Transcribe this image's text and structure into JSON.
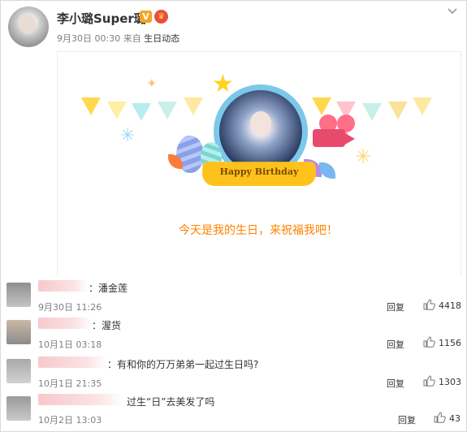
{
  "post": {
    "author": "李小璐Super璐",
    "verified_badge": "V",
    "crown_badge": "♛",
    "date": "9月30日 00:30",
    "from_label": "来自",
    "source": "生日动态",
    "card": {
      "ribbon_text": "Happy Birthday",
      "headline": "今天是我的生日，来祝福我吧！"
    }
  },
  "comments": [
    {
      "text": "：潘金莲",
      "time": "9月30日 11:26",
      "reply": "回复",
      "likes": "4418"
    },
    {
      "text": "：渥货",
      "time": "10月1日 03:18",
      "reply": "回复",
      "likes": "1156"
    },
    {
      "text": "：有和你的万万弟弟一起过生日吗?",
      "time": "10月1日 21:35",
      "reply": "回复",
      "likes": "1303"
    },
    {
      "text": "过生“日”去美发了吗",
      "time": "10月2日 13:03",
      "reply": "回复",
      "likes": "43"
    }
  ],
  "colors": {
    "accent": "#ff8200",
    "ribbon": "#ffc21c",
    "star": "#ffd21f"
  },
  "icons": {
    "menu": "chevron-down-icon",
    "like": "thumbs-up-icon"
  }
}
